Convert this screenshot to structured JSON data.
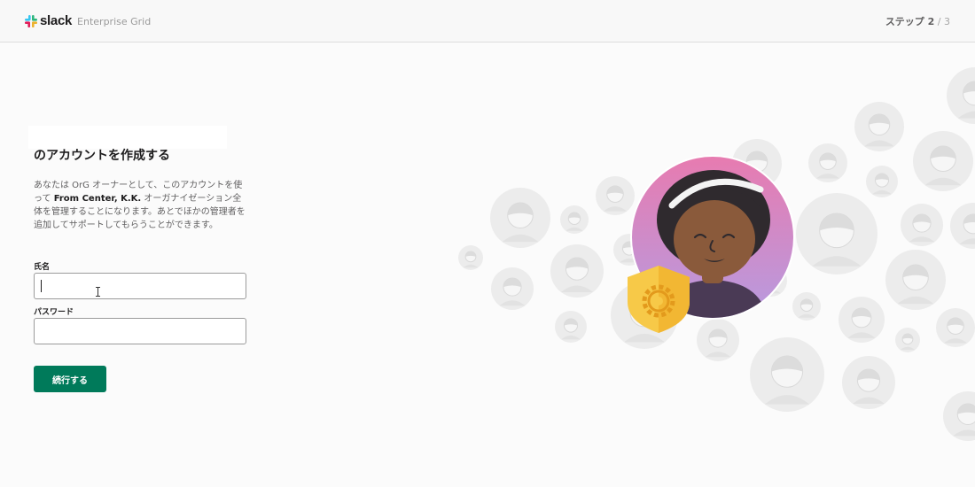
{
  "header": {
    "brand": "slack",
    "product": "Enterprise Grid",
    "step_label": "ステップ 2",
    "step_total": " / 3"
  },
  "form": {
    "title": "のアカウントを作成する",
    "description_prefix": "あなたは OrG オーナーとして、このアカウントを使って ",
    "org_name": "From Center, K.K.",
    "description_suffix": " オーガナイゼーション全体を管理することになります。あとでほかの管理者を追加してサポートしてもらうことができます。",
    "name_label": "氏名",
    "name_value": "",
    "password_label": "パスワード",
    "password_value": "",
    "continue_label": "続行する"
  },
  "icons": {
    "logo": "slack-hash-logo-icon",
    "cursor": "text-cursor-icon",
    "admin_shield": "shield-gear-icon",
    "illustration": "admin-avatar-illustration"
  },
  "colors": {
    "primary_button": "#007a5a",
    "avatar_gradient_top": "#e77bb0",
    "avatar_gradient_bottom": "#b79be0",
    "shield": "#f7c948"
  }
}
